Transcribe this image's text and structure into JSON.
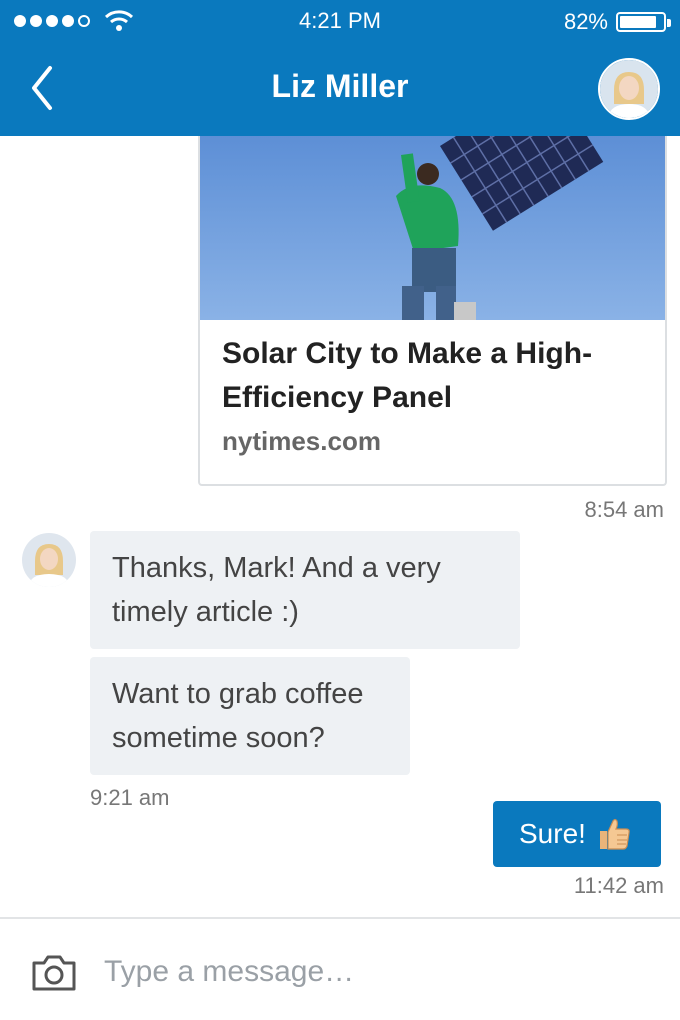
{
  "status_bar": {
    "time": "4:21 PM",
    "battery_percent": "82%",
    "signal_bars_filled": 4,
    "signal_bars_total": 5
  },
  "nav": {
    "title": "Liz Miller"
  },
  "shared_article": {
    "title": "Solar City to Make a High-Efficiency Panel",
    "source": "nytimes.com",
    "timestamp": "8:54 am"
  },
  "incoming": {
    "messages": [
      {
        "text": "Thanks, Mark! And a very timely article :)"
      },
      {
        "text": "Want to grab coffee sometime soon?"
      }
    ],
    "timestamp": "9:21 am"
  },
  "outgoing": {
    "text": "Sure!",
    "emoji_icon": "thumbs-up-icon",
    "timestamp": "11:42 am"
  },
  "composer": {
    "placeholder": "Type a message…"
  },
  "colors": {
    "brand_blue": "#0a79be",
    "bubble_gray": "#eef1f4"
  }
}
